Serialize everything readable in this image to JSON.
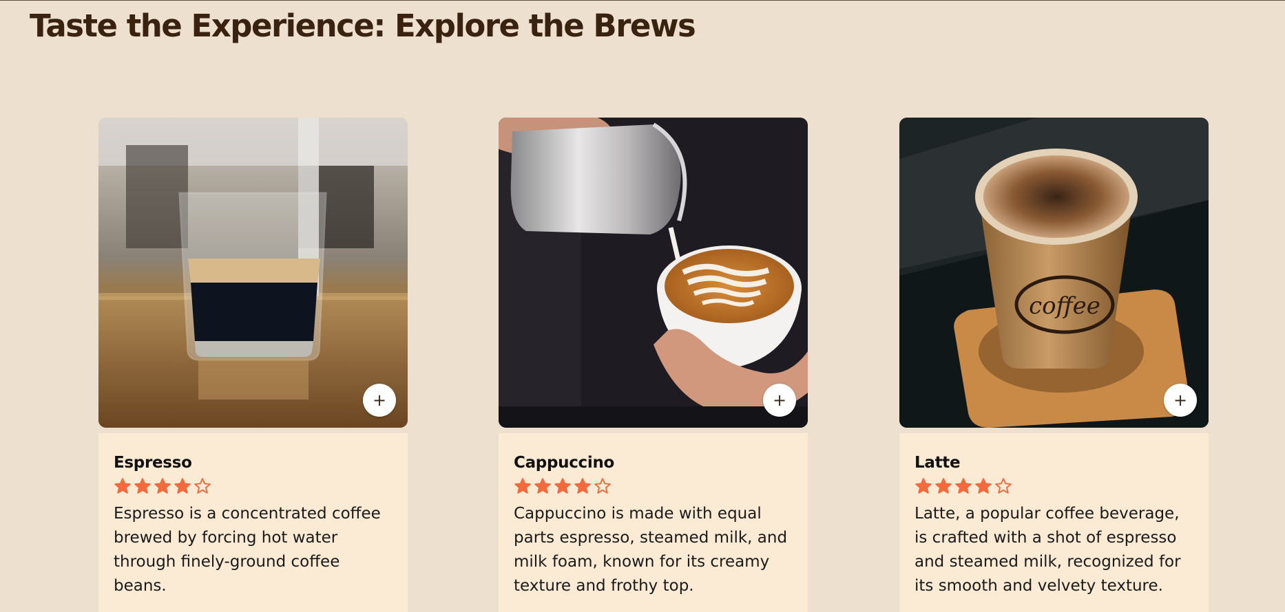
{
  "page": {
    "title": "Taste the Experience: Explore the Brews"
  },
  "colors": {
    "background": "#ede0cf",
    "card_body": "#fbead4",
    "title": "#3a2210",
    "star": "#f26a3d"
  },
  "products": [
    {
      "name": "Espresso",
      "rating": 4,
      "max_rating": 5,
      "description": "Espresso is a concentrated coffee brewed by forcing hot water through finely-ground coffee beans.",
      "add_label": "+",
      "image_icon": "espresso-glass-photo"
    },
    {
      "name": "Cappuccino",
      "rating": 4,
      "max_rating": 5,
      "description": "Cappuccino is made with equal parts espresso, steamed milk, and milk foam, known for its creamy texture and frothy top.",
      "add_label": "+",
      "image_icon": "latte-art-pour-photo"
    },
    {
      "name": "Latte",
      "rating": 4,
      "max_rating": 5,
      "description": "Latte, a popular coffee beverage, is crafted with a shot of espresso and steamed milk, recognized for its smooth and velvety texture.",
      "add_label": "+",
      "image_icon": "paper-cup-coffee-photo"
    }
  ]
}
